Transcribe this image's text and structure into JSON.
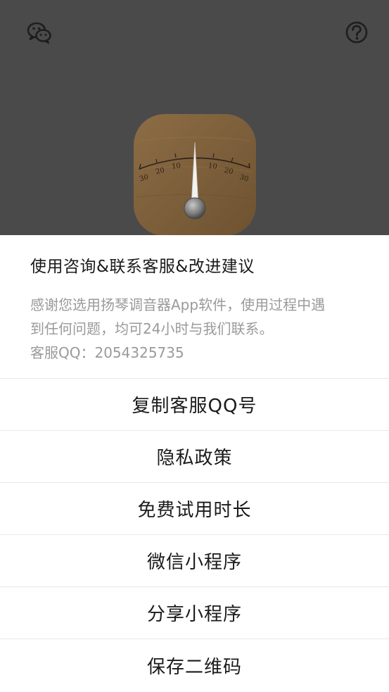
{
  "top_bar": {
    "left_icon": "wechat-icon",
    "right_icon": "help-icon"
  },
  "tuner": {
    "scale_labels": [
      "30",
      "20",
      "10",
      "10",
      "20",
      "30"
    ]
  },
  "sheet": {
    "title": "使用咨询&联系客服&改进建议",
    "description_line1": "感谢您选用扬琴调音器App软件，使用过程中遇",
    "description_line2": "到任何问题，均可24小时与我们联系。",
    "qq_line": "客服QQ：2054325735",
    "menu": [
      {
        "label": "复制客服QQ号"
      },
      {
        "label": "隐私政策"
      },
      {
        "label": "免费试用时长"
      },
      {
        "label": "微信小程序"
      },
      {
        "label": "分享小程序"
      },
      {
        "label": "保存二维码"
      }
    ]
  }
}
